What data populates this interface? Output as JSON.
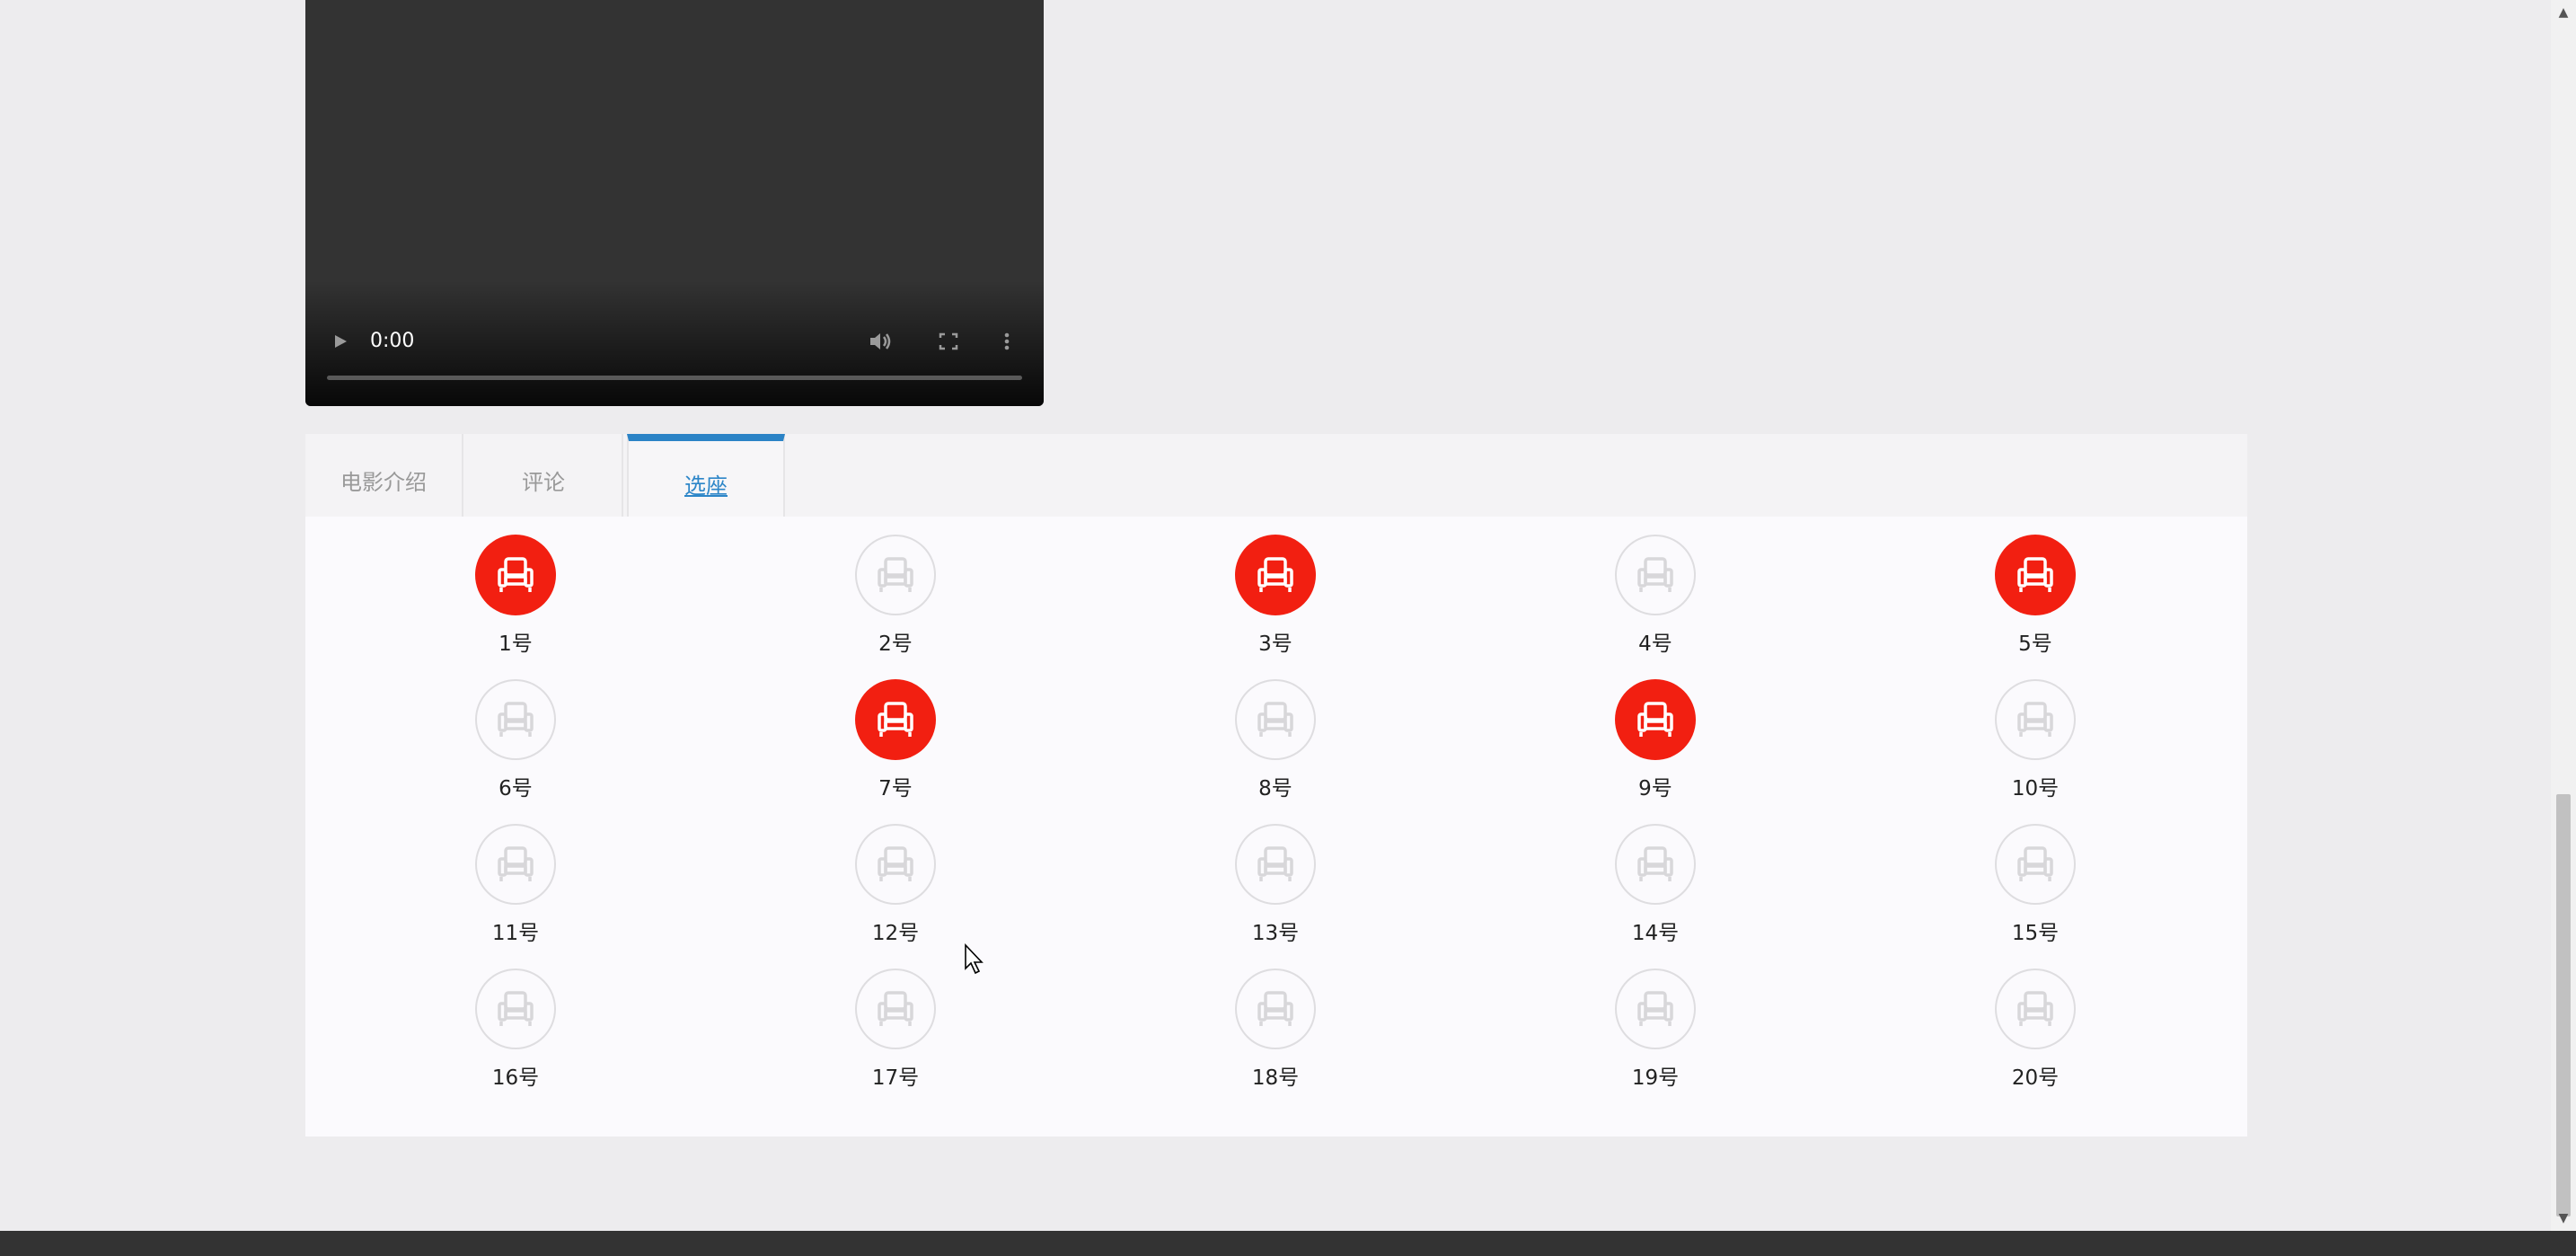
{
  "video": {
    "time": "0:00",
    "play_icon": "play-icon",
    "volume_icon": "volume-icon",
    "fullscreen_icon": "fullscreen-icon",
    "more_icon": "more-options-icon"
  },
  "tabs": [
    {
      "label": "电影介绍",
      "active": false
    },
    {
      "label": "评论",
      "active": false
    },
    {
      "label": "选座",
      "active": true
    }
  ],
  "seats": [
    {
      "label": "1号",
      "taken": true
    },
    {
      "label": "2号",
      "taken": false
    },
    {
      "label": "3号",
      "taken": true
    },
    {
      "label": "4号",
      "taken": false
    },
    {
      "label": "5号",
      "taken": true
    },
    {
      "label": "6号",
      "taken": false
    },
    {
      "label": "7号",
      "taken": true
    },
    {
      "label": "8号",
      "taken": false
    },
    {
      "label": "9号",
      "taken": true
    },
    {
      "label": "10号",
      "taken": false
    },
    {
      "label": "11号",
      "taken": false
    },
    {
      "label": "12号",
      "taken": false
    },
    {
      "label": "13号",
      "taken": false
    },
    {
      "label": "14号",
      "taken": false
    },
    {
      "label": "15号",
      "taken": false
    },
    {
      "label": "16号",
      "taken": false
    },
    {
      "label": "17号",
      "taken": false
    },
    {
      "label": "18号",
      "taken": false
    },
    {
      "label": "19号",
      "taken": false
    },
    {
      "label": "20号",
      "taken": false
    }
  ],
  "colors": {
    "taken_seat": "#f21f11",
    "free_seat_outline": "#dedde0",
    "active_tab": "#2b83c6"
  }
}
